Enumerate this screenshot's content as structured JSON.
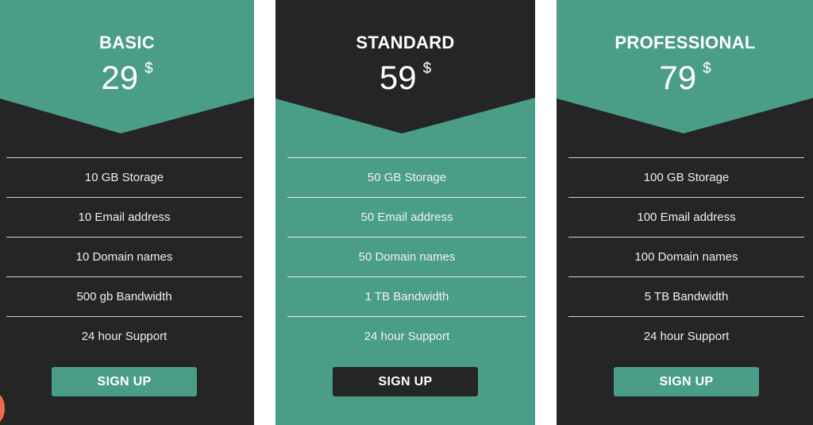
{
  "colors": {
    "accent_green": "#4a9d87",
    "dark": "#252525",
    "floating_button": "#ee6a4c"
  },
  "plans": [
    {
      "name": "BASIC",
      "price": "29",
      "currency": "$",
      "theme": "green-header-dark-body",
      "features": [
        "10 GB Storage",
        "10 Email address",
        "10 Domain names",
        "500 gb Bandwidth",
        "24 hour Support"
      ],
      "button_label": "SIGN UP"
    },
    {
      "name": "STANDARD",
      "price": "59",
      "currency": "$",
      "theme": "dark-header-green-body",
      "features": [
        "50 GB Storage",
        "50 Email address",
        "50 Domain names",
        "1 TB Bandwidth",
        "24 hour Support"
      ],
      "button_label": "SIGN UP"
    },
    {
      "name": "PROFESSIONAL",
      "price": "79",
      "currency": "$",
      "theme": "green-header-dark-body",
      "features": [
        "100 GB Storage",
        "100 Email address",
        "100 Domain names",
        "5 TB Bandwidth",
        "24 hour Support"
      ],
      "button_label": "SIGN UP"
    }
  ],
  "floating_button": {
    "icon": "circle-button-icon"
  }
}
